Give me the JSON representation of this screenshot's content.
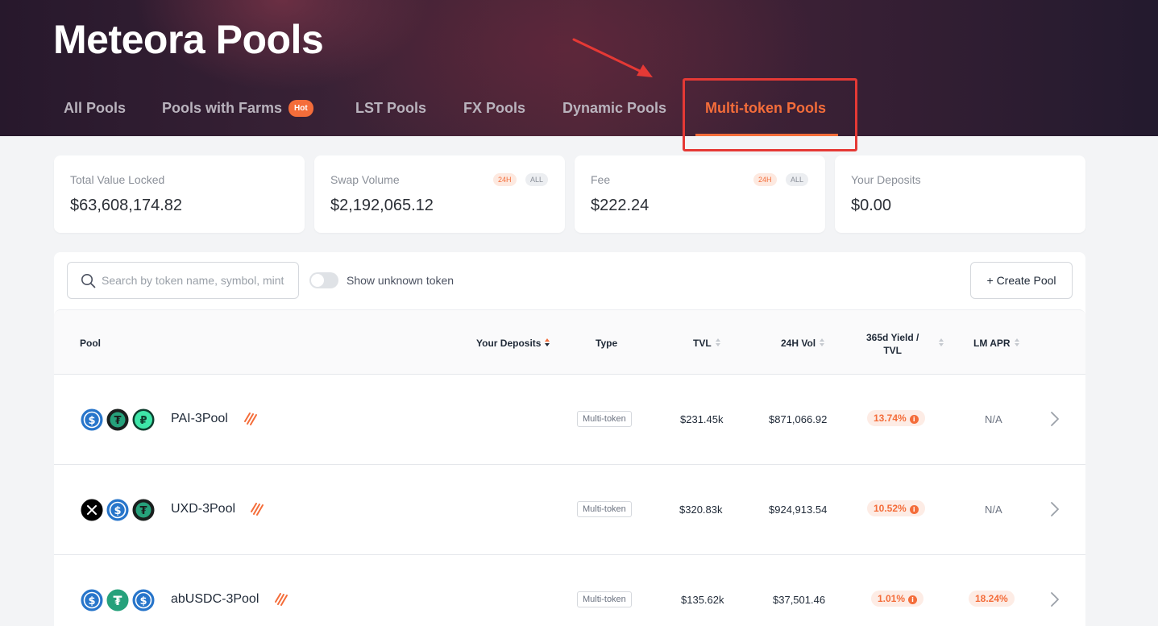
{
  "header": {
    "title": "Meteora Pools",
    "tabs": [
      {
        "label": "All Pools"
      },
      {
        "label": "Pools with Farms",
        "badge": "Hot"
      },
      {
        "label": "LST Pools"
      },
      {
        "label": "FX Pools"
      },
      {
        "label": "Dynamic Pools"
      },
      {
        "label": "Multi-token Pools",
        "active": true
      }
    ]
  },
  "stats": [
    {
      "label": "Total Value Locked",
      "value": "$63,608,174.82"
    },
    {
      "label": "Swap Volume",
      "value": "$2,192,065.12",
      "pill_24h": "24H",
      "pill_all": "ALL"
    },
    {
      "label": "Fee",
      "value": "$222.24",
      "pill_24h": "24H",
      "pill_all": "ALL"
    },
    {
      "label": "Your Deposits",
      "value": "$0.00"
    }
  ],
  "toolbar": {
    "search_placeholder": "Search by token name, symbol, mint",
    "toggle_label": "Show unknown token",
    "create_label": "+ Create Pool"
  },
  "table": {
    "headers": {
      "pool": "Pool",
      "deposits": "Your Deposits",
      "type": "Type",
      "tvl": "TVL",
      "vol": "24H Vol",
      "yield_line1": "365d Yield /",
      "yield_line2": "TVL",
      "lm_apr": "LM APR"
    },
    "rows": [
      {
        "name": "PAI-3Pool",
        "type": "Multi-token",
        "tvl": "$231.45k",
        "vol": "$871,066.92",
        "yield": "13.74%",
        "lm_apr": "N/A",
        "tokens": [
          "usdc-icon",
          "usdt-dark-icon",
          "pai-icon"
        ]
      },
      {
        "name": "UXD-3Pool",
        "type": "Multi-token",
        "tvl": "$320.83k",
        "vol": "$924,913.54",
        "yield": "10.52%",
        "lm_apr": "N/A",
        "tokens": [
          "uxd-icon",
          "usdc-icon",
          "usdt-dark-icon"
        ]
      },
      {
        "name": "abUSDC-3Pool",
        "type": "Multi-token",
        "tvl": "$135.62k",
        "vol": "$37,501.46",
        "yield": "1.01%",
        "lm_apr": "18.24%",
        "tokens": [
          "usdc-icon",
          "usdt-icon",
          "usdc-icon"
        ]
      }
    ]
  },
  "colors": {
    "accent": "#f46d3a",
    "annotation": "#e53935"
  }
}
